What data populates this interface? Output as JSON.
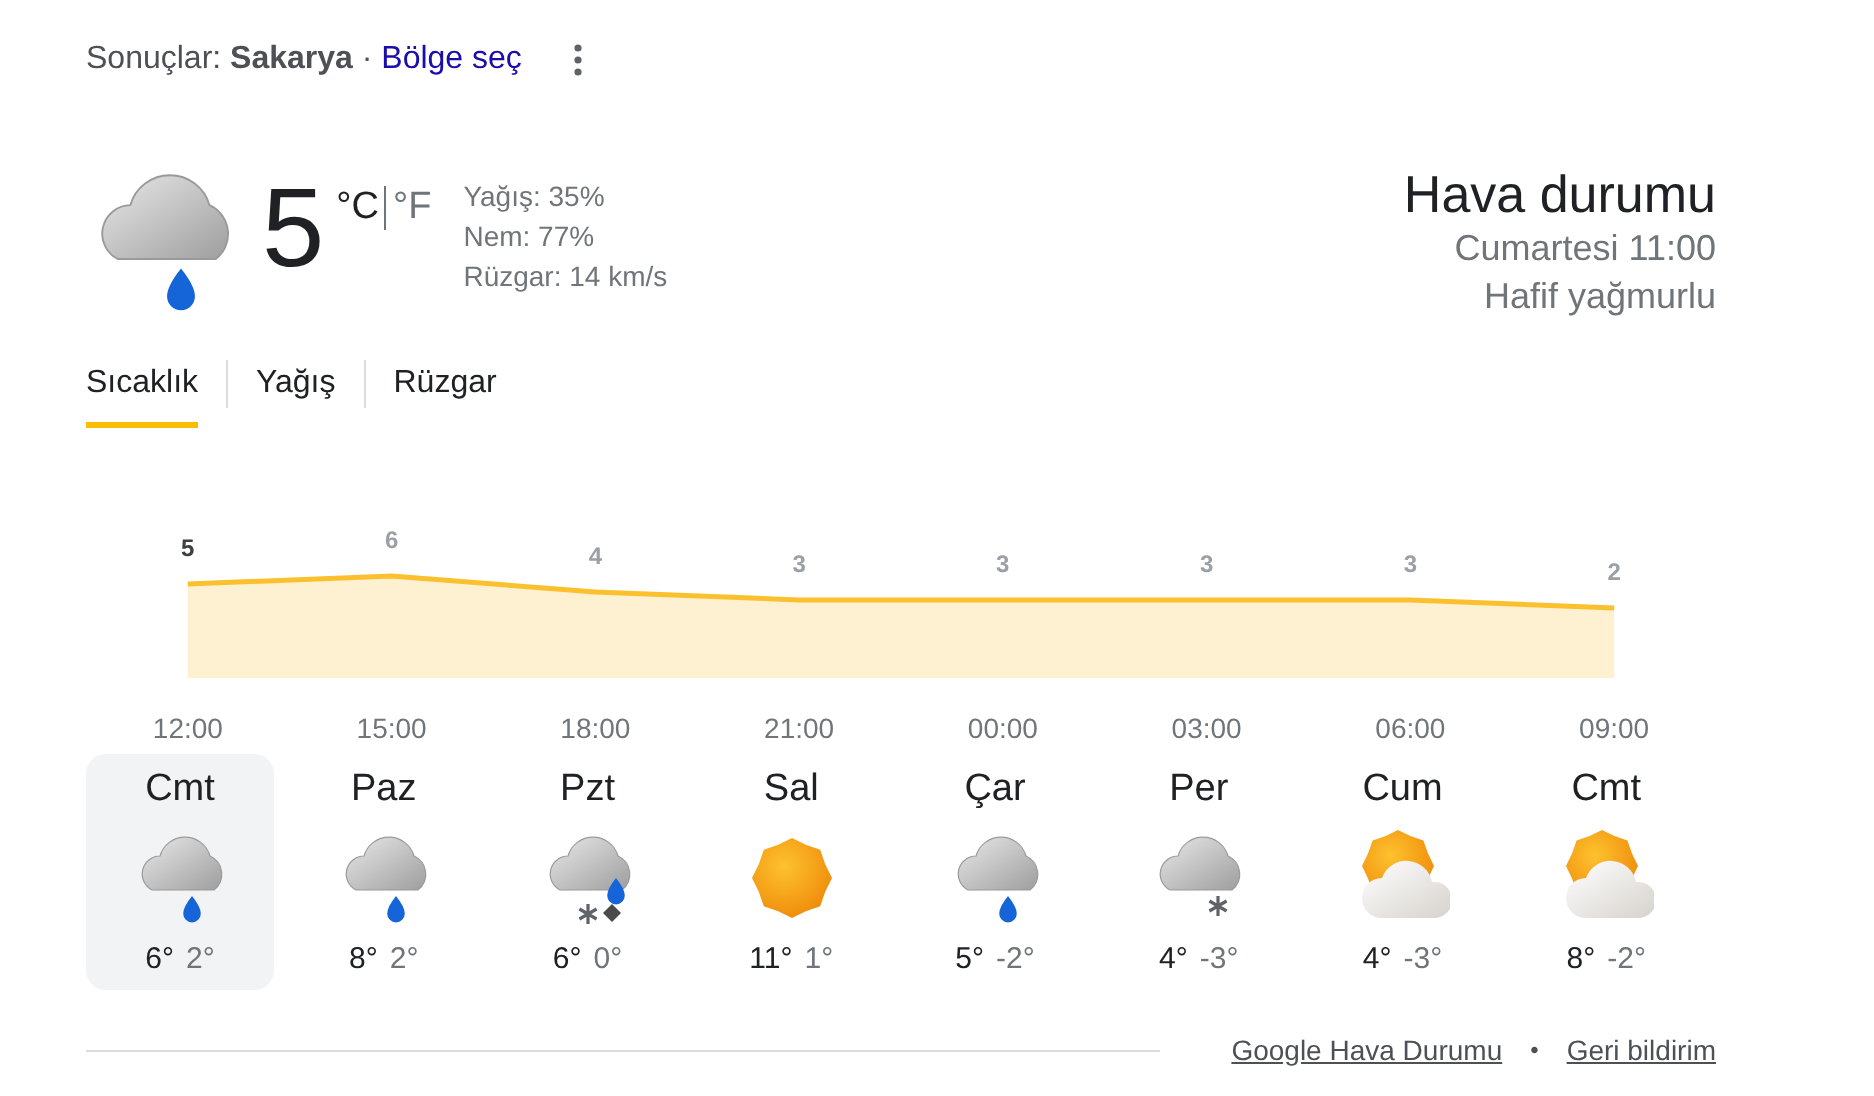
{
  "header": {
    "text": "Sonuçlar: **Sakarya** · ",
    "link": "Bölge seç"
  },
  "current": {
    "kind": "rain",
    "temperature": "5",
    "units": [
      {
        "label": "°C",
        "selected": true
      },
      {
        "label": "°F",
        "selected": false
      }
    ],
    "details": [
      "Yağış: 35%",
      "Nem: 77%",
      "Rüzgar: 14 km/s"
    ],
    "title": "Hava durumu",
    "time": "Cumartesi 11:00",
    "condition": "Hafif yağmurlu"
  },
  "tabs": [
    {
      "label": "Sıcaklık",
      "selected": true
    },
    {
      "label": "Yağış",
      "selected": false
    },
    {
      "label": "Rüzgar",
      "selected": false
    }
  ],
  "hourly": {
    "chart_data": {
      "type": "area",
      "categories": [
        "12:00",
        "15:00",
        "18:00",
        "21:00",
        "00:00",
        "03:00",
        "06:00",
        "09:00"
      ],
      "series": [
        {
          "color": "#fbc02d",
          "values": [
            5,
            6,
            4,
            3,
            3,
            3,
            3,
            2
          ]
        }
      ],
      "data_labels": true
    }
  },
  "days": [
    {
      "day": "Cmt",
      "kind": "rain",
      "high": "6°",
      "low": "2°",
      "selected": true
    },
    {
      "day": "Paz",
      "kind": "rain",
      "high": "8°",
      "low": "2°",
      "selected": false
    },
    {
      "day": "Pzt",
      "kind": "mixed",
      "high": "6°",
      "low": "0°",
      "selected": false
    },
    {
      "day": "Sal",
      "kind": "sunny",
      "high": "11°",
      "low": "1°",
      "selected": false
    },
    {
      "day": "Çar",
      "kind": "rain",
      "high": "5°",
      "low": "-2°",
      "selected": false
    },
    {
      "day": "Per",
      "kind": "snow",
      "high": "4°",
      "low": "-3°",
      "selected": false
    },
    {
      "day": "Cum",
      "kind": "partly_cloudy",
      "high": "4°",
      "low": "-3°",
      "selected": false
    },
    {
      "day": "Cmt",
      "kind": "partly_cloudy",
      "high": "8°",
      "low": "-2°",
      "selected": false
    }
  ],
  "footer": {
    "links": [
      "Google Hava Durumu",
      "Geri bildirim"
    ],
    "separator": "•"
  }
}
